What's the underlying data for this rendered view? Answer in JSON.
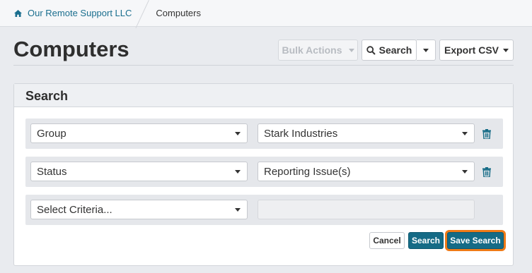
{
  "breadcrumb": {
    "home_icon": "home-icon",
    "org": "Our Remote Support LLC",
    "current": "Computers"
  },
  "page": {
    "title": "Computers"
  },
  "toolbar": {
    "bulk_actions": "Bulk Actions",
    "search": "Search",
    "search_icon": "search-icon",
    "export": "Export CSV"
  },
  "panel": {
    "title": "Search",
    "criteria": [
      {
        "field": "Group",
        "value": "Stark Industries"
      },
      {
        "field": "Status",
        "value": "Reporting Issue(s)"
      },
      {
        "field": "Select Criteria...",
        "value": ""
      }
    ],
    "buttons": {
      "cancel": "Cancel",
      "search": "Search",
      "save": "Save Search"
    }
  },
  "colors": {
    "accent": "#156b86",
    "link": "#1a6e8e",
    "highlight": "#ef7a17",
    "background": "#e9ebef"
  }
}
